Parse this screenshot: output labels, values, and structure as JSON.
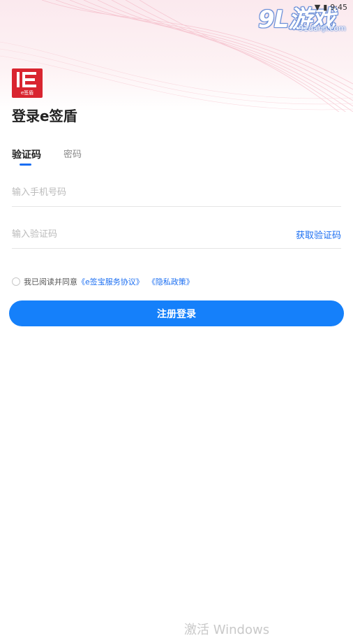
{
  "watermark": {
    "brand": "9L游戏",
    "domain": "91danji.com"
  },
  "status_bar": {
    "time": "9:45"
  },
  "logo": {
    "caption": "e签盾"
  },
  "page_title": "登录e签盾",
  "tabs": [
    {
      "label": "验证码",
      "active": true
    },
    {
      "label": "密码",
      "active": false
    }
  ],
  "form": {
    "phone_placeholder": "输入手机号码",
    "code_placeholder": "输入验证码",
    "get_code_label": "获取验证码"
  },
  "agreement": {
    "prefix": "我已阅读并同意",
    "service_link": "《e签宝服务协议》",
    "privacy_link": "《隐私政策》"
  },
  "submit_label": "注册登录",
  "os_overlay": {
    "activate_text": "激活 Windows"
  },
  "colors": {
    "accent": "#1580fa",
    "link": "#1a6ef2",
    "brand_red": "#d92530"
  }
}
